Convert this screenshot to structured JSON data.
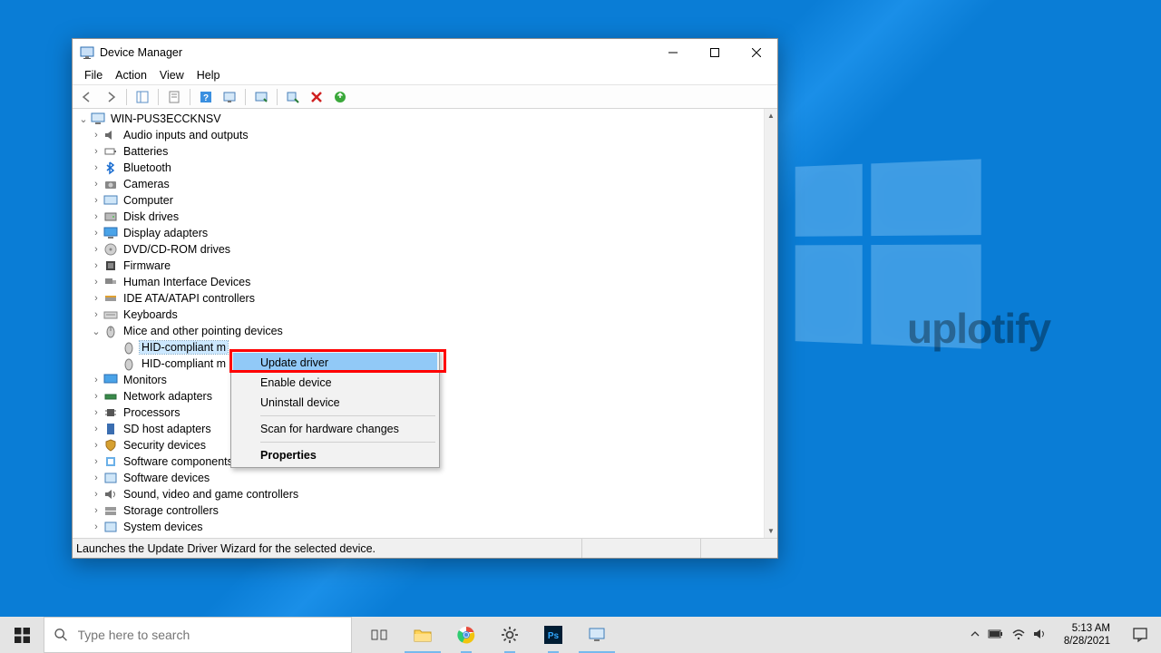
{
  "window": {
    "title": "Device Manager",
    "status": "Launches the Update Driver Wizard for the selected device."
  },
  "menus": {
    "file": "File",
    "action": "Action",
    "view": "View",
    "help": "Help"
  },
  "tree": {
    "root": "WIN-PUS3ECCKNSV",
    "n0": "Audio inputs and outputs",
    "n1": "Batteries",
    "n2": "Bluetooth",
    "n3": "Cameras",
    "n4": "Computer",
    "n5": "Disk drives",
    "n6": "Display adapters",
    "n7": "DVD/CD-ROM drives",
    "n8": "Firmware",
    "n9": "Human Interface Devices",
    "n10": "IDE ATA/ATAPI controllers",
    "n11": "Keyboards",
    "n12": "Mice and other pointing devices",
    "n12a": "HID-compliant m",
    "n12b": "HID-compliant m",
    "n13": "Monitors",
    "n14": "Network adapters",
    "n15": "Processors",
    "n16": "SD host adapters",
    "n17": "Security devices",
    "n18": "Software components",
    "n19": "Software devices",
    "n20": "Sound, video and game controllers",
    "n21": "Storage controllers",
    "n22": "System devices"
  },
  "context_menu": {
    "update": "Update driver",
    "enable": "Enable device",
    "uninstall": "Uninstall device",
    "scan": "Scan for hardware changes",
    "properties": "Properties"
  },
  "watermark": "uplotify",
  "taskbar": {
    "search_placeholder": "Type here to search",
    "time": "5:13 AM",
    "date": "8/28/2021"
  }
}
